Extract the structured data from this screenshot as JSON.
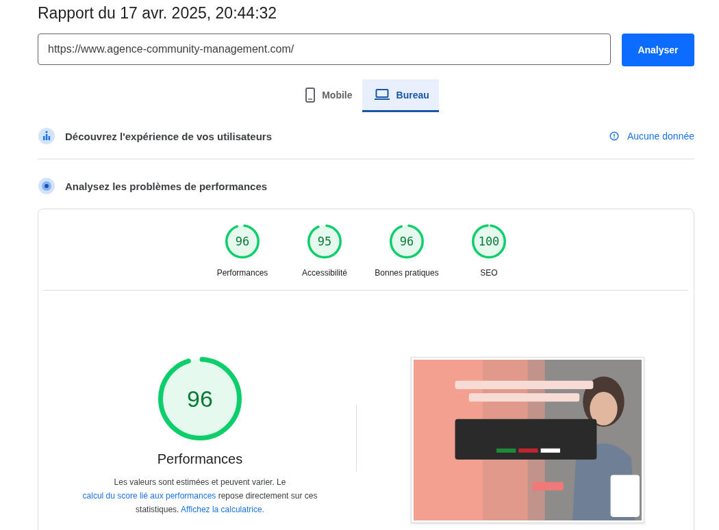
{
  "title": "Rapport du 17 avr. 2025, 20:44:32",
  "url_field": {
    "value": "https://www.agence-community-management.com/"
  },
  "analyze_button": "Analyser",
  "device_tabs": [
    {
      "label": "Mobile",
      "kind": "phone",
      "selected": false
    },
    {
      "label": "Bureau",
      "kind": "laptop",
      "selected": true
    }
  ],
  "field_section": {
    "title": "Découvrez l'expérience de vos utilisateurs",
    "status": "Aucune donnée"
  },
  "lab_section": {
    "title": "Analysez les problèmes de performances"
  },
  "category_scores": [
    {
      "score": "96",
      "label": "Performances",
      "level": 0.96
    },
    {
      "score": "95",
      "label": "Accessibilité",
      "level": 0.95
    },
    {
      "score": "96",
      "label": "Bonnes pratiques",
      "level": 0.96
    },
    {
      "score": "100",
      "label": "SEO",
      "level": 1.0
    }
  ],
  "performance": {
    "score": "96",
    "level": 0.96,
    "title": "Performances",
    "description": [
      {
        "kind": "text",
        "text": "Les valeurs sont estimées et peuvent varier. Le "
      },
      {
        "kind": "link",
        "text": "calcul du score lié aux performances"
      },
      {
        "kind": "text",
        "text": " repose directement sur ces statistiques. "
      },
      {
        "kind": "link",
        "text": "Affichez la calculatrice."
      }
    ]
  }
}
